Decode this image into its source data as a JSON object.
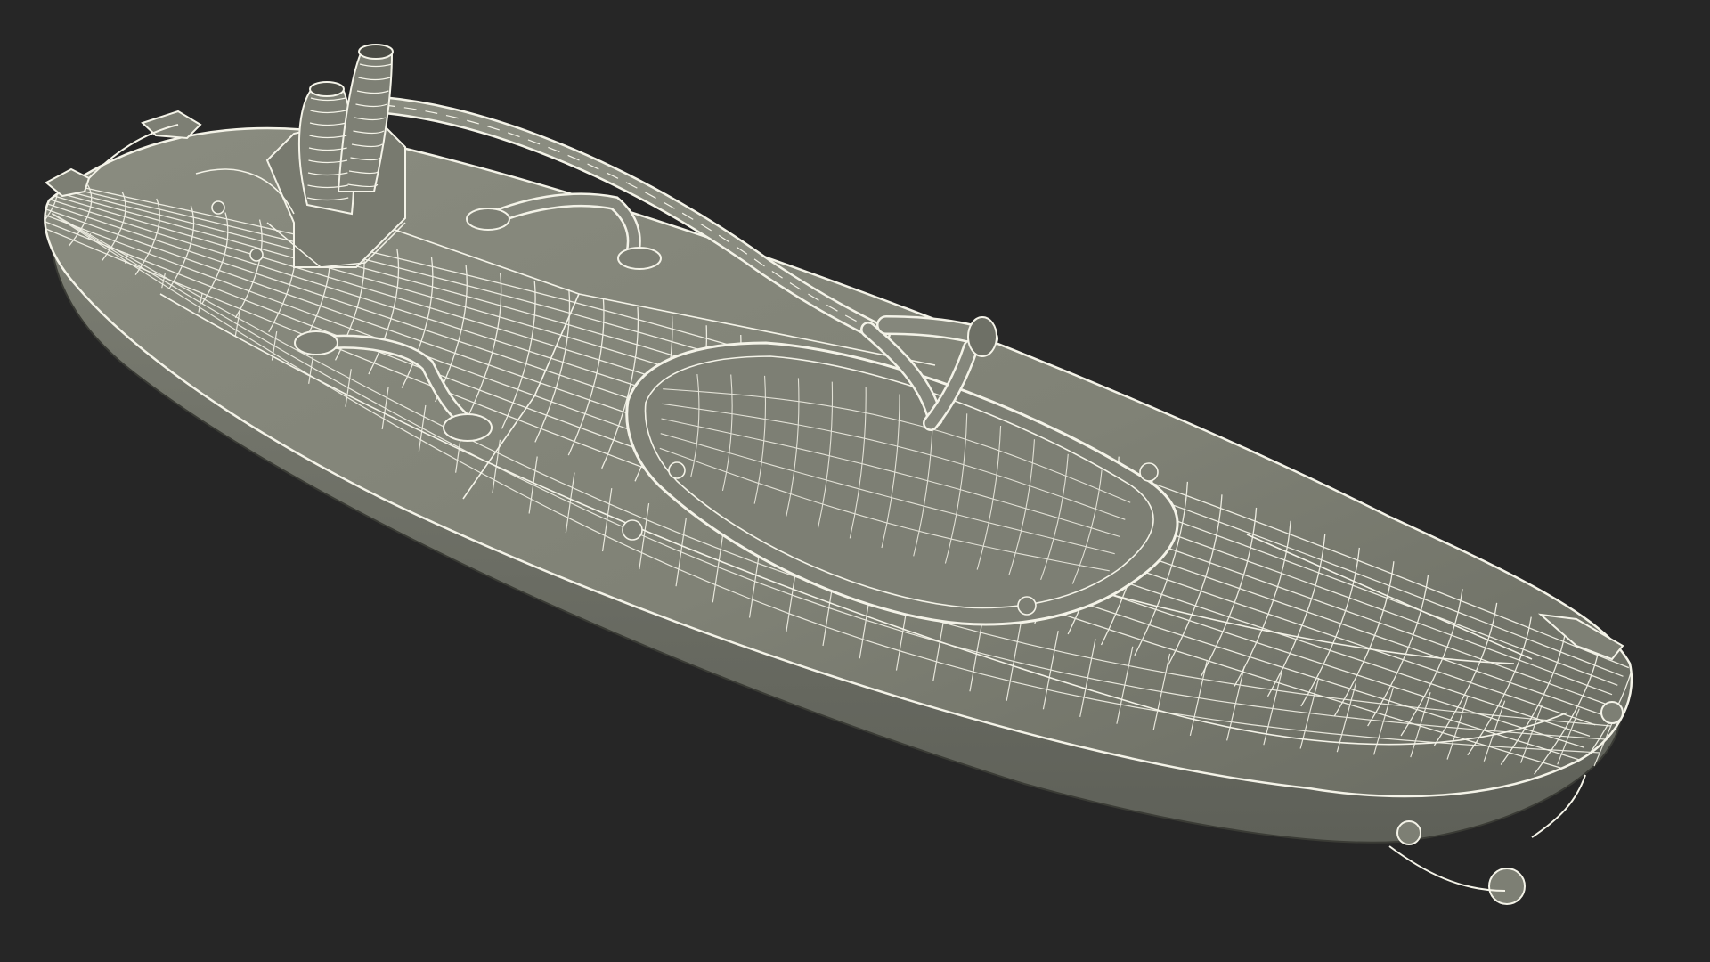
{
  "scene": {
    "subject": "wireframe-hull-model",
    "colors": {
      "background": "#262626",
      "surface": "#85877c",
      "surface_shade": "#6e7066",
      "surface_light": "#9a9c90",
      "wire": "#f4f3e8",
      "outline": "#3a3b35"
    }
  }
}
